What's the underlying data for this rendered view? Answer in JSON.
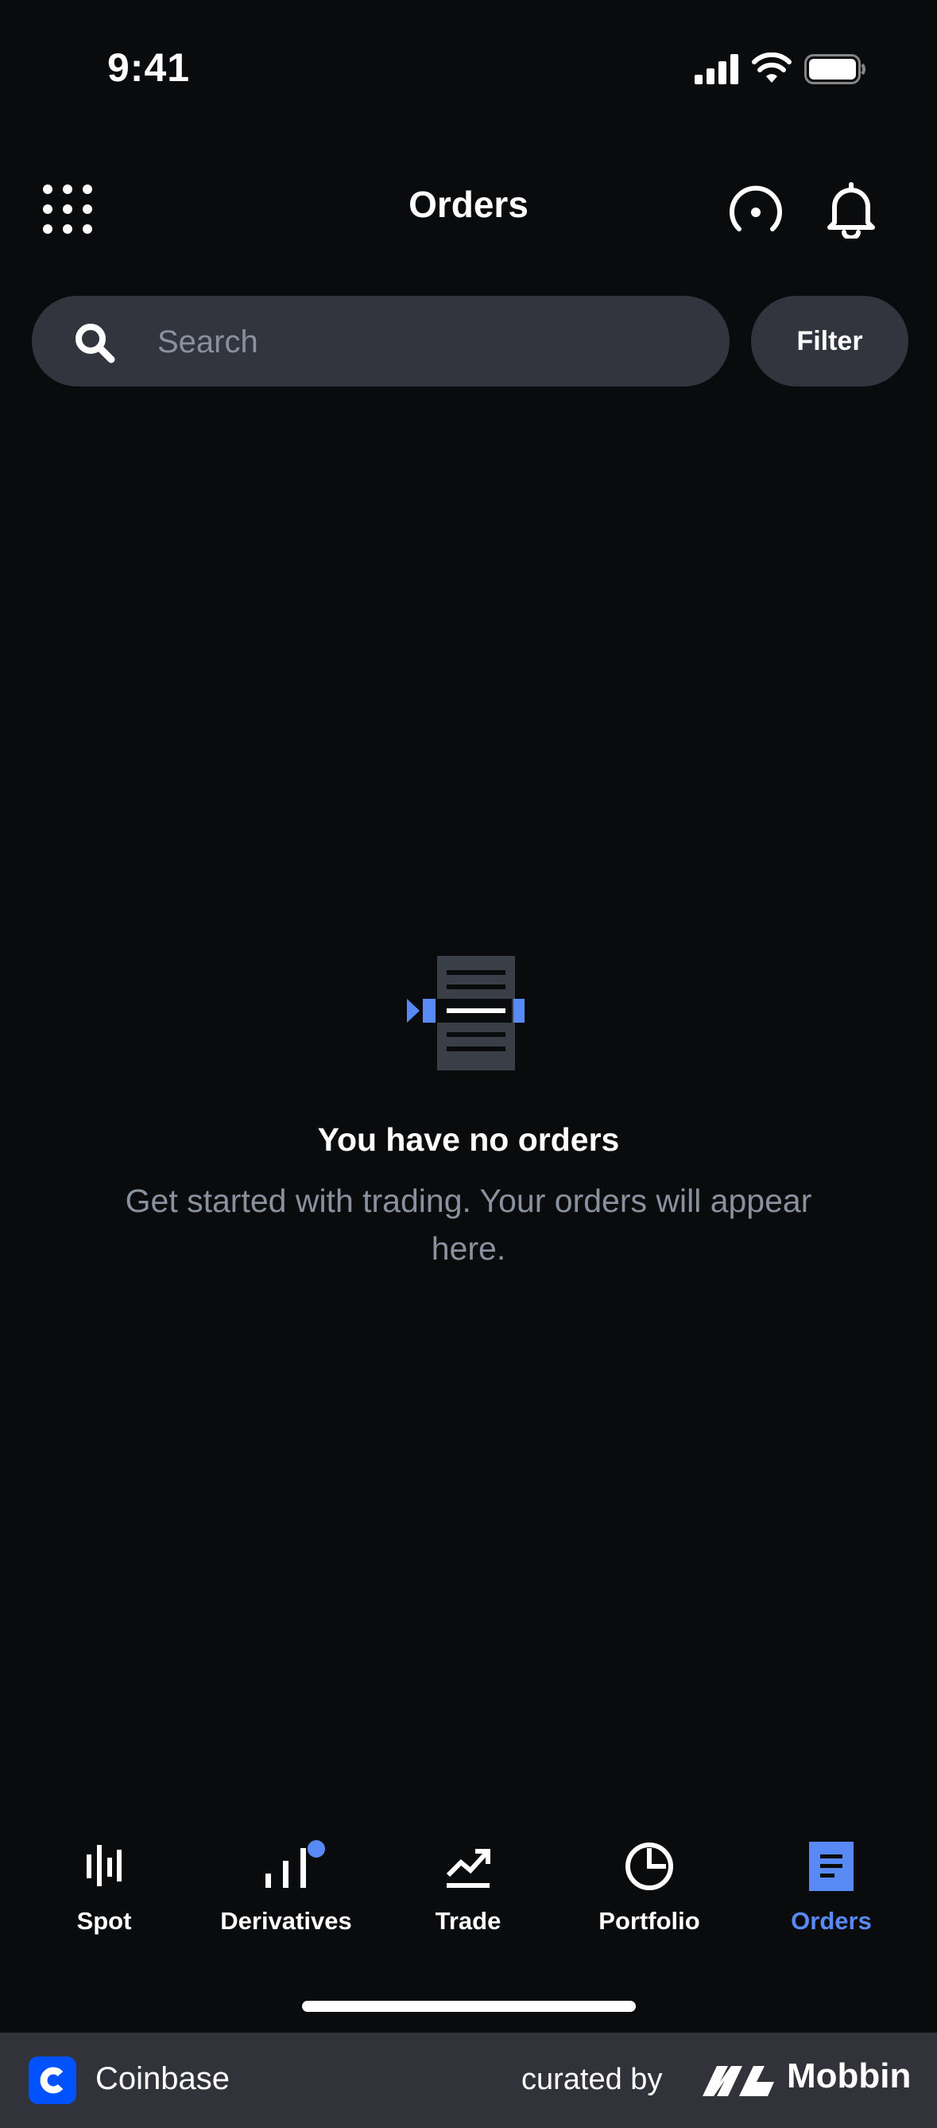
{
  "status_bar": {
    "time": "9:41"
  },
  "header": {
    "title": "Orders"
  },
  "search": {
    "placeholder": "Search"
  },
  "filter": {
    "label": "Filter"
  },
  "empty_state": {
    "title": "You have no orders",
    "description": "Get started with trading. Your orders will appear here."
  },
  "tabs": [
    {
      "label": "Spot",
      "icon": "candlestick-icon",
      "active": false
    },
    {
      "label": "Derivatives",
      "icon": "bar-chart-icon",
      "active": false,
      "badge": true
    },
    {
      "label": "Trade",
      "icon": "trend-up-icon",
      "active": false
    },
    {
      "label": "Portfolio",
      "icon": "pie-chart-icon",
      "active": false
    },
    {
      "label": "Orders",
      "icon": "document-icon",
      "active": true
    }
  ],
  "footer": {
    "brand": "Coinbase",
    "curated_by": "curated by",
    "mobbin": "Mobbin"
  },
  "colors": {
    "background": "#0a0b0d",
    "surface": "#32353d",
    "accent": "#588af5",
    "muted_text": "#8a919e"
  }
}
